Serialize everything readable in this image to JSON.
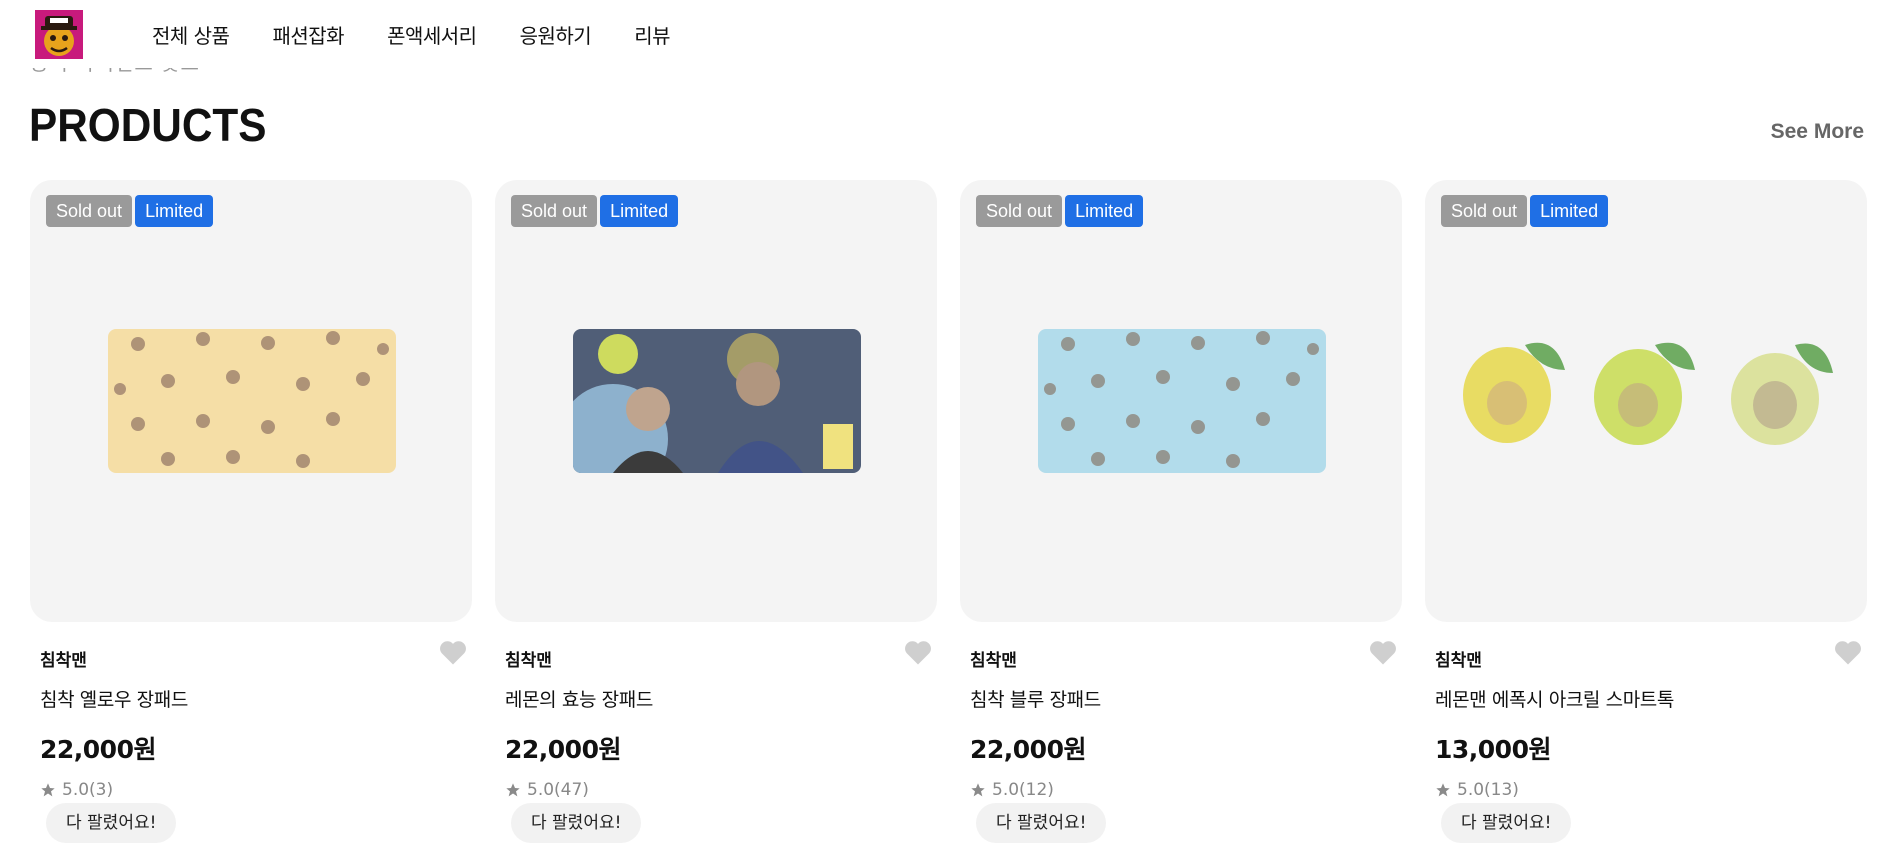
{
  "header": {
    "nav": [
      "전체 상품",
      "패션잡화",
      "폰액세서리",
      "응원하기",
      "리뷰"
    ]
  },
  "section": {
    "cut_text": "공식 라이선스 굿즈",
    "title": "PRODUCTS",
    "see_more": "See More"
  },
  "products": [
    {
      "badge_soldout": "Sold out",
      "badge_limited": "Limited",
      "brand": "침착맨",
      "name": "침착 옐로우 장패드",
      "price": "22,000원",
      "rating": "5.0",
      "reviews": "(3)",
      "button": "다 팔렸어요!",
      "image": "yellow-pattern-desk-pad",
      "color": "#f6dc9c"
    },
    {
      "badge_soldout": "Sold out",
      "badge_limited": "Limited",
      "brand": "침착맨",
      "name": "레몬의 효능 장패드",
      "price": "22,000원",
      "rating": "5.0",
      "reviews": "(47)",
      "button": "다 팔렸어요!",
      "image": "lemon-collage-desk-pad",
      "color": "#5a6b84"
    },
    {
      "badge_soldout": "Sold out",
      "badge_limited": "Limited",
      "brand": "침착맨",
      "name": "침착 블루 장패드",
      "price": "22,000원",
      "rating": "5.0",
      "reviews": "(12)",
      "button": "다 팔렸어요!",
      "image": "blue-pattern-desk-pad",
      "color": "#a9d9ea"
    },
    {
      "badge_soldout": "Sold out",
      "badge_limited": "Limited",
      "brand": "침착맨",
      "name": "레몬맨 에폭시 아크릴 스마트톡",
      "price": "13,000원",
      "rating": "5.0",
      "reviews": "(13)",
      "button": "다 팔렸어요!",
      "image": "lemon-face-smarttoks",
      "color": "#e8e060"
    }
  ],
  "colors": {
    "accent": "#1f6fe5",
    "soldout_badge": "#9a9a9a",
    "card_bg": "#f4f4f4",
    "muted": "#888888"
  }
}
